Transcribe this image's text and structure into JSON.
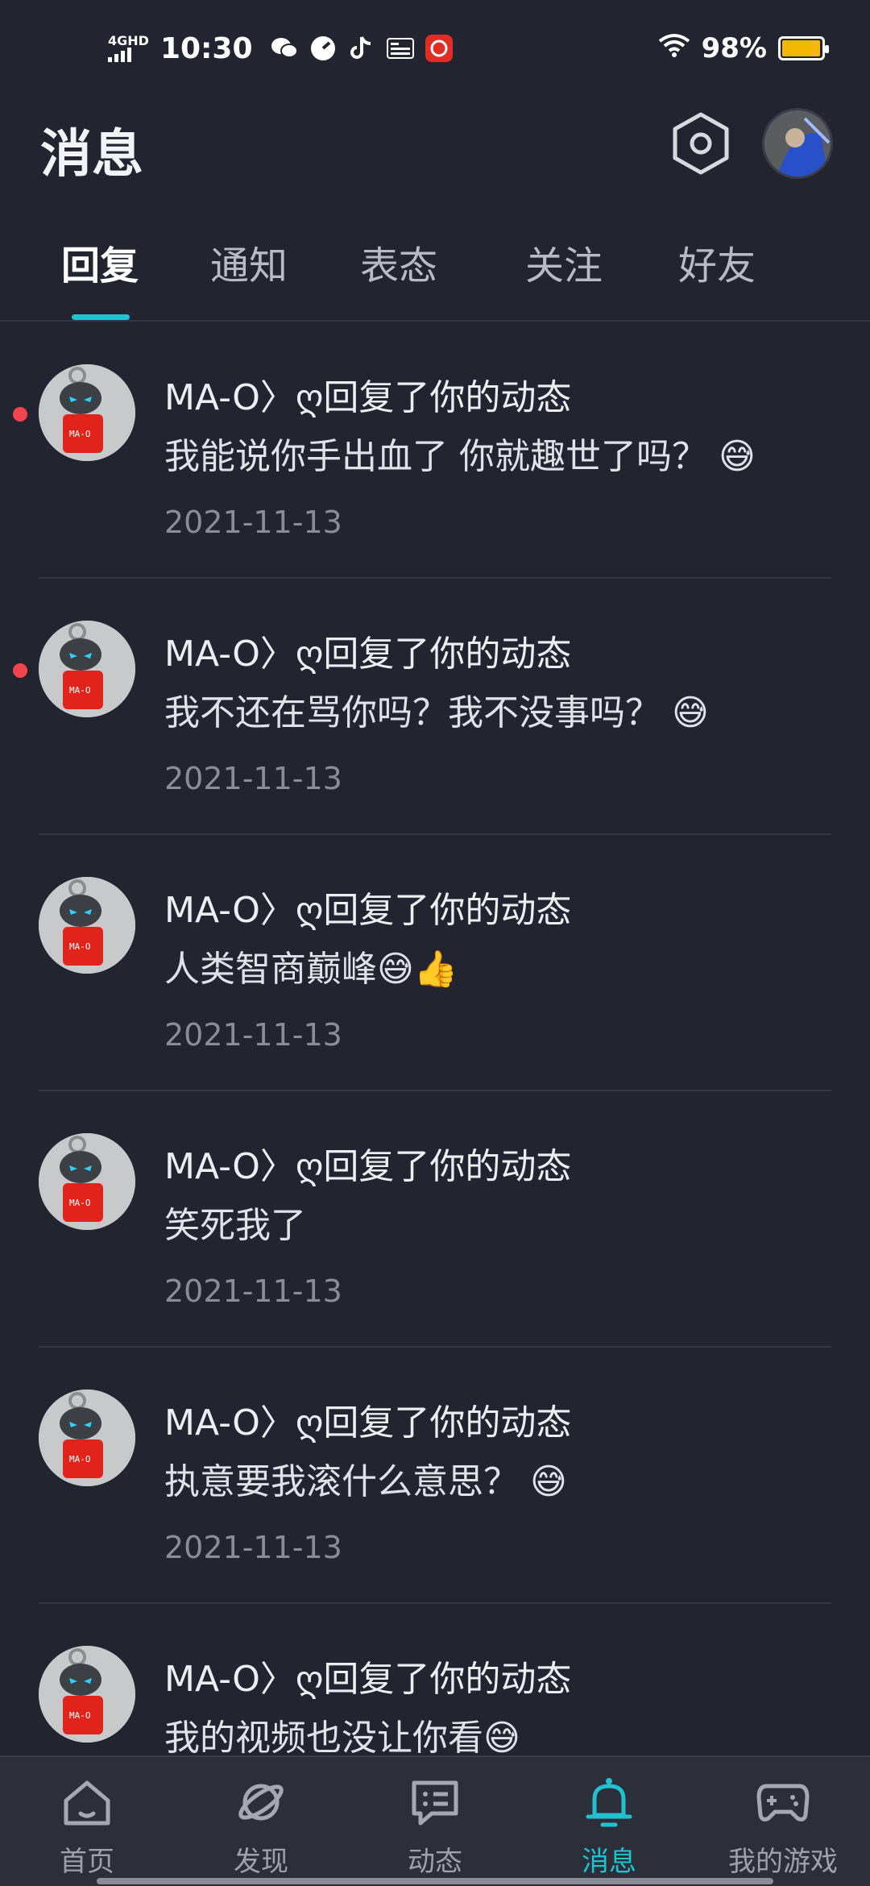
{
  "status_bar": {
    "network": "4GHD",
    "time": "10:30",
    "battery_percent": "98%",
    "battery_level": 0.98,
    "app_icons": [
      "wechat-icon",
      "speed-icon",
      "tiktok-icon",
      "toutiao-icon",
      "pinduoduo-icon"
    ]
  },
  "header": {
    "title": "消息"
  },
  "tabs": [
    {
      "label": "回复",
      "active": true
    },
    {
      "label": "通知",
      "active": false
    },
    {
      "label": "表态",
      "active": false
    },
    {
      "label": "关注",
      "active": false
    },
    {
      "label": "好友",
      "active": false
    }
  ],
  "messages": [
    {
      "user": "MA-O〉ღ",
      "action": "回复了你的动态",
      "text": "我能说你手出血了 你就趣世了吗？ 😅",
      "date": "2021-11-13",
      "unread": true
    },
    {
      "user": "MA-O〉ღ",
      "action": "回复了你的动态",
      "text": "我不还在骂你吗？我不没事吗？ 😅",
      "date": "2021-11-13",
      "unread": true
    },
    {
      "user": "MA-O〉ღ",
      "action": "回复了你的动态",
      "text": "人类智商巅峰😅👍",
      "date": "2021-11-13",
      "unread": false
    },
    {
      "user": "MA-O〉ღ",
      "action": "回复了你的动态",
      "text": "笑死我了",
      "date": "2021-11-13",
      "unread": false
    },
    {
      "user": "MA-O〉ღ",
      "action": "回复了你的动态",
      "text": "执意要我滚什么意思？ 😅",
      "date": "2021-11-13",
      "unread": false
    },
    {
      "user": "MA-O〉ღ",
      "action": "回复了你的动态",
      "text": "我的视频也没让你看😅",
      "date": "",
      "unread": false
    }
  ],
  "bottom_nav": [
    {
      "label": "首页",
      "icon": "home-icon",
      "active": false
    },
    {
      "label": "发现",
      "icon": "planet-icon",
      "active": false
    },
    {
      "label": "动态",
      "icon": "chat-icon",
      "active": false
    },
    {
      "label": "消息",
      "icon": "bell-icon",
      "active": true
    },
    {
      "label": "我的游戏",
      "icon": "gamepad-icon",
      "active": false
    }
  ],
  "colors": {
    "background": "#22252f",
    "accent": "#1fc3cf",
    "unread_dot": "#f2444d",
    "battery": "#f5b800"
  }
}
